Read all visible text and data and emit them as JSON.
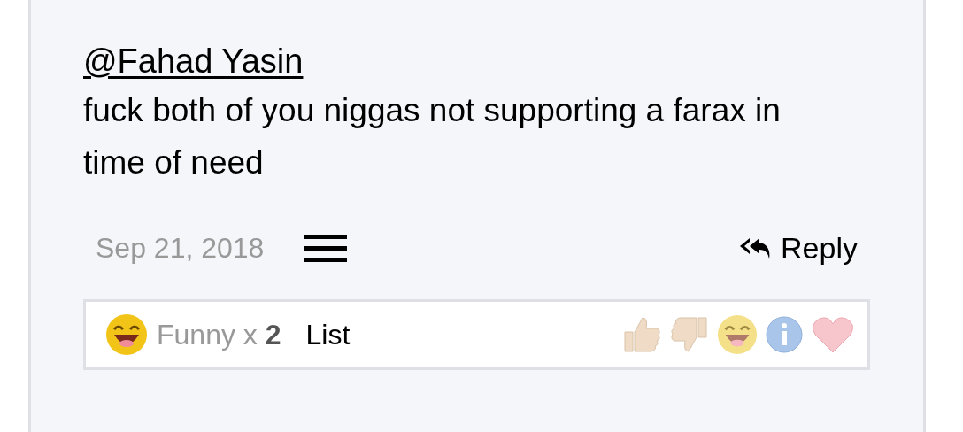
{
  "post": {
    "mention": "@Fahad Yasin",
    "body": "fuck both of you niggas not supporting a farax in time of need",
    "date": "Sep 21, 2018",
    "reply": "Reply"
  },
  "reactions": {
    "summary": "Funny x **2**",
    "list_link": "List"
  }
}
